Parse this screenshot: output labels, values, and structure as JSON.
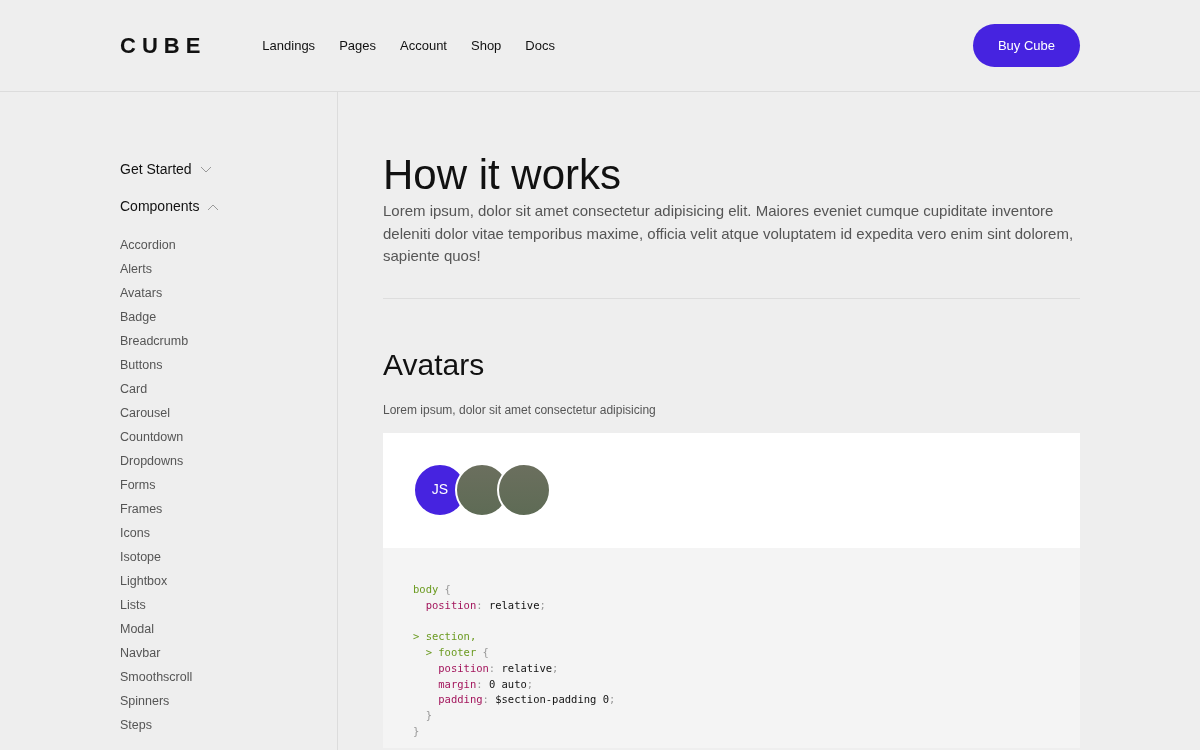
{
  "brand": "CUBE",
  "nav": [
    {
      "label": "Landings"
    },
    {
      "label": "Pages"
    },
    {
      "label": "Account"
    },
    {
      "label": "Shop"
    },
    {
      "label": "Docs"
    }
  ],
  "cta": {
    "label": "Buy Cube"
  },
  "sidebar": {
    "sections": [
      {
        "label": "Get Started",
        "expanded": false
      },
      {
        "label": "Components",
        "expanded": true,
        "children": [
          {
            "label": "Accordion"
          },
          {
            "label": "Alerts"
          },
          {
            "label": "Avatars"
          },
          {
            "label": "Badge"
          },
          {
            "label": "Breadcrumb"
          },
          {
            "label": "Buttons"
          },
          {
            "label": "Card"
          },
          {
            "label": "Carousel"
          },
          {
            "label": "Countdown"
          },
          {
            "label": "Dropdowns"
          },
          {
            "label": "Forms"
          },
          {
            "label": "Frames"
          },
          {
            "label": "Icons"
          },
          {
            "label": "Isotope"
          },
          {
            "label": "Lightbox"
          },
          {
            "label": "Lists"
          },
          {
            "label": "Modal"
          },
          {
            "label": "Navbar"
          },
          {
            "label": "Smoothscroll"
          },
          {
            "label": "Spinners"
          },
          {
            "label": "Steps"
          }
        ]
      }
    ]
  },
  "page": {
    "title": "How it works",
    "intro": "Lorem ipsum, dolor sit amet consectetur adipisicing elit. Maiores eveniet cumque cupiditate inventore deleniti dolor vitae temporibus maxime, officia velit atque voluptatem id expedita vero enim sint dolorem, sapiente quos!"
  },
  "section": {
    "title": "Avatars",
    "subtitle": "Lorem ipsum, dolor sit amet consectetur adipisicing",
    "avatars": [
      {
        "kind": "initials",
        "text": "JS",
        "color": "#4623e0"
      },
      {
        "kind": "photo"
      },
      {
        "kind": "photo"
      }
    ],
    "code_blocks": [
      {
        "lines": [
          [
            {
              "kind": "selector",
              "text": "body"
            },
            {
              "kind": "punct",
              "text": " {"
            }
          ],
          [
            {
              "kind": "property",
              "text": "  position"
            },
            {
              "kind": "punct",
              "text": ": "
            },
            {
              "kind": "value",
              "text": "relative"
            },
            {
              "kind": "punct",
              "text": ";"
            }
          ]
        ]
      },
      {
        "lines": [
          [
            {
              "kind": "selector",
              "text": "> section,"
            }
          ],
          [
            {
              "kind": "selector",
              "text": "  > footer"
            },
            {
              "kind": "punct",
              "text": " {"
            }
          ],
          [
            {
              "kind": "property",
              "text": "    position"
            },
            {
              "kind": "punct",
              "text": ": "
            },
            {
              "kind": "value",
              "text": "relative"
            },
            {
              "kind": "punct",
              "text": ";"
            }
          ],
          [
            {
              "kind": "property",
              "text": "    margin"
            },
            {
              "kind": "punct",
              "text": ": "
            },
            {
              "kind": "value",
              "text": "0 auto"
            },
            {
              "kind": "punct",
              "text": ";"
            }
          ],
          [
            {
              "kind": "property",
              "text": "    padding"
            },
            {
              "kind": "punct",
              "text": ": "
            },
            {
              "kind": "value",
              "text": "$section-padding 0"
            },
            {
              "kind": "punct",
              "text": ";"
            }
          ],
          [
            {
              "kind": "punct",
              "text": "  }"
            }
          ],
          [
            {
              "kind": "punct",
              "text": "}"
            }
          ]
        ]
      }
    ]
  }
}
